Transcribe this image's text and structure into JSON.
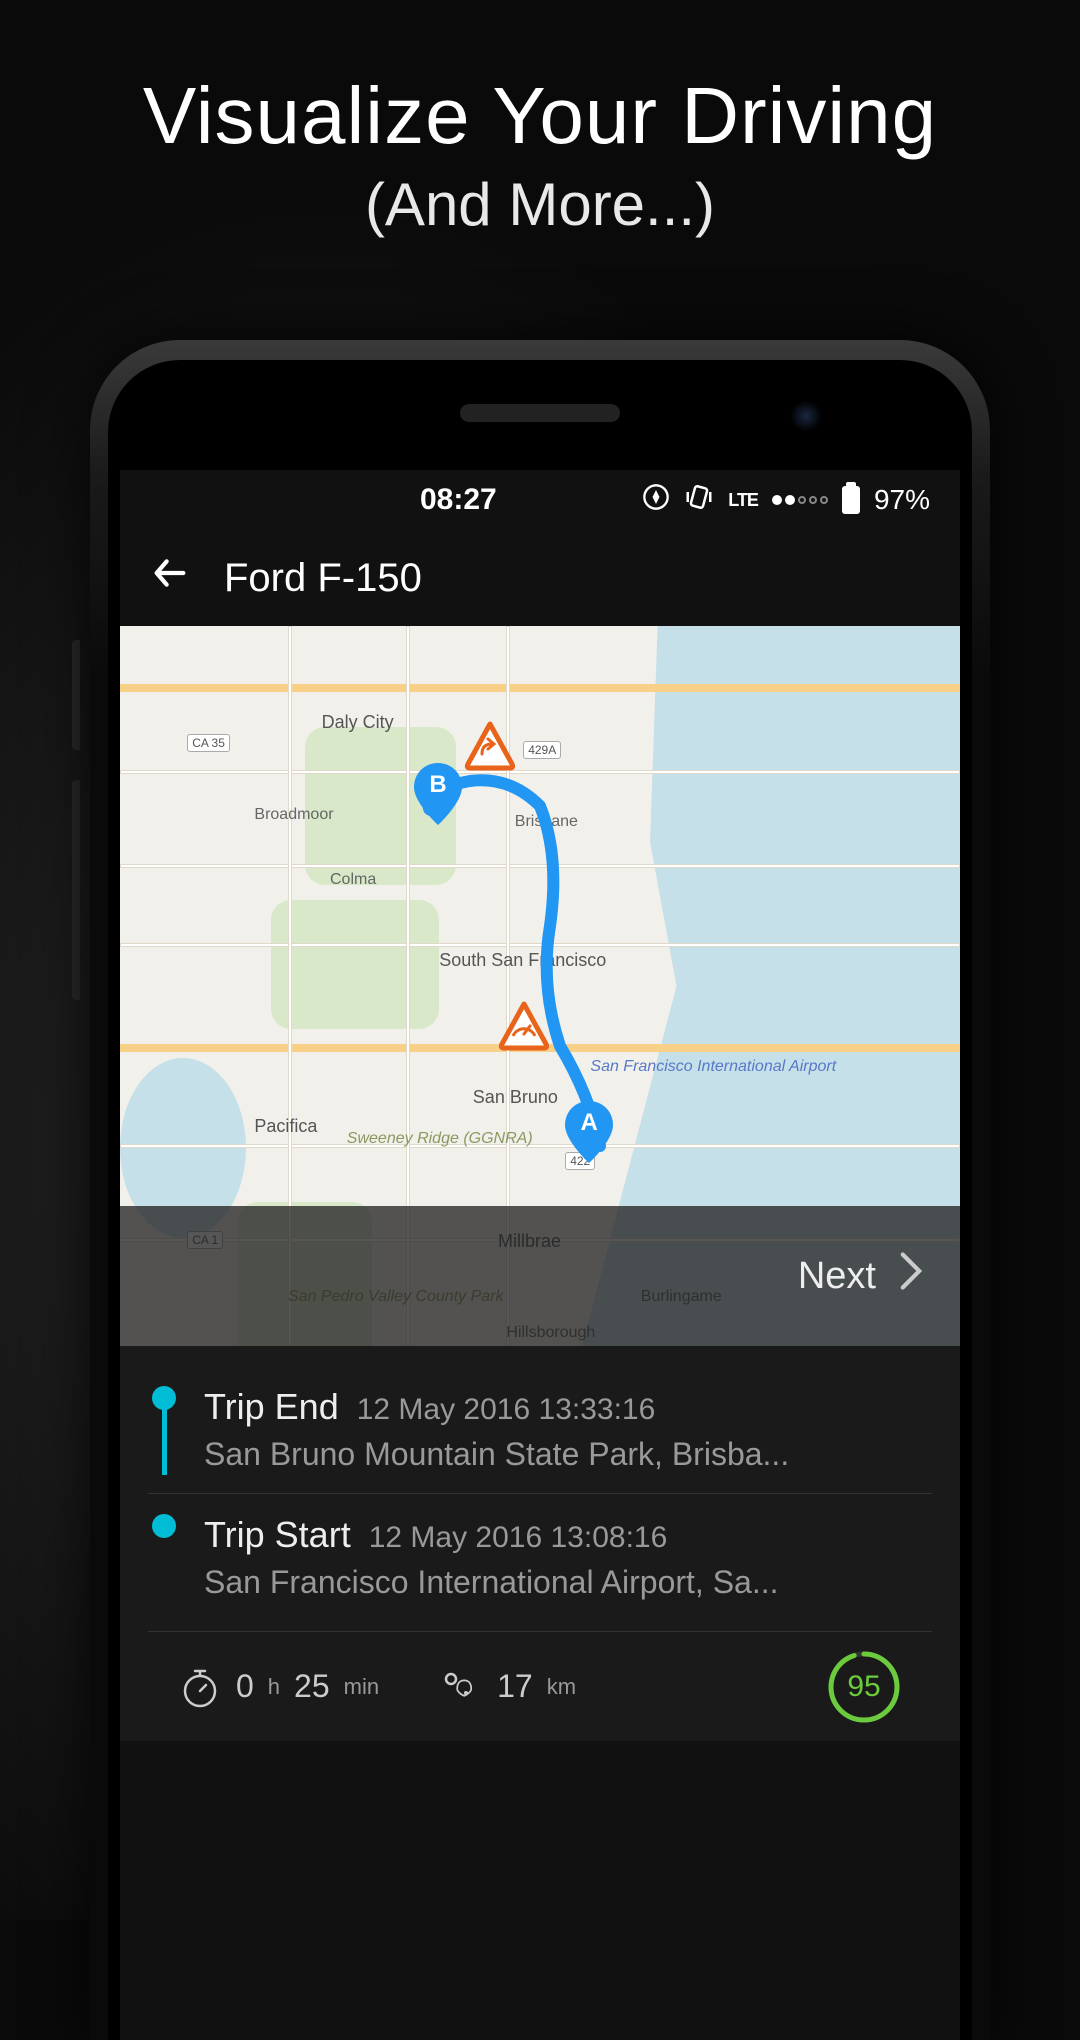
{
  "promo": {
    "title": "Visualize Your Driving",
    "subtitle": "(And More...)"
  },
  "status": {
    "time": "08:27",
    "network": "LTE",
    "battery_pct": "97%"
  },
  "header": {
    "title": "Ford F-150"
  },
  "map": {
    "next_label": "Next",
    "pins": {
      "a": "A",
      "b": "B"
    },
    "labels": {
      "daly_city": "Daly City",
      "broadmoor": "Broadmoor",
      "colma": "Colma",
      "s_sf": "South San Francisco",
      "brisbane": "Brisbane",
      "san_bruno": "San Bruno",
      "pacifica": "Pacifica",
      "millbrae": "Millbrae",
      "burlingame": "Burlingame",
      "hillsborough": "Hillsborough",
      "airport": "San Francisco International Airport",
      "sweeney": "Sweeney Ridge (GGNRA)",
      "san_pedro": "San Pedro Valley County Park"
    }
  },
  "trips": {
    "end": {
      "label": "Trip End",
      "timestamp": "12 May 2016 13:33:16",
      "location": "San Bruno Mountain State Park, Brisba..."
    },
    "start": {
      "label": "Trip Start",
      "timestamp": "12 May 2016 13:08:16",
      "location": "San Francisco International Airport, Sa..."
    }
  },
  "stats": {
    "duration_h": "0",
    "duration_h_unit": "h",
    "duration_m": "25",
    "duration_m_unit": "min",
    "distance": "17",
    "distance_unit": "km",
    "score": "95"
  }
}
